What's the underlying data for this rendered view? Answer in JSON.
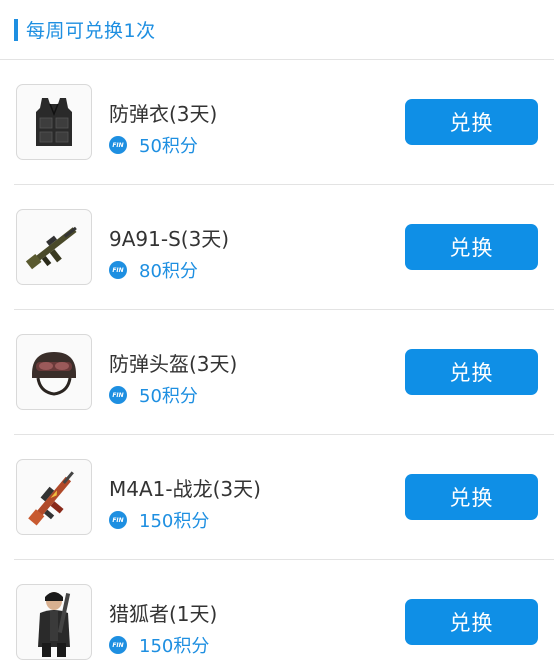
{
  "header": {
    "title": "每周可兑换1次"
  },
  "colors": {
    "accent": "#1e8fe1",
    "button": "#0f8fe6",
    "text": "#333333",
    "divider": "#e3e3e3"
  },
  "coin_label": "FIN",
  "items": [
    {
      "name": "防弹衣(3天)",
      "points": "50积分",
      "button": "兑换",
      "icon": "body-armor-vest-icon"
    },
    {
      "name": "9A91-S(3天)",
      "points": "80积分",
      "button": "兑换",
      "icon": "rifle-9a91-icon"
    },
    {
      "name": "防弹头盔(3天)",
      "points": "50积分",
      "button": "兑换",
      "icon": "helmet-icon"
    },
    {
      "name": "M4A1-战龙(3天)",
      "points": "150积分",
      "button": "兑换",
      "icon": "rifle-m4a1-dragon-icon"
    },
    {
      "name": "猎狐者(1天)",
      "points": "150积分",
      "button": "兑换",
      "icon": "character-fox-hunter-icon"
    }
  ]
}
